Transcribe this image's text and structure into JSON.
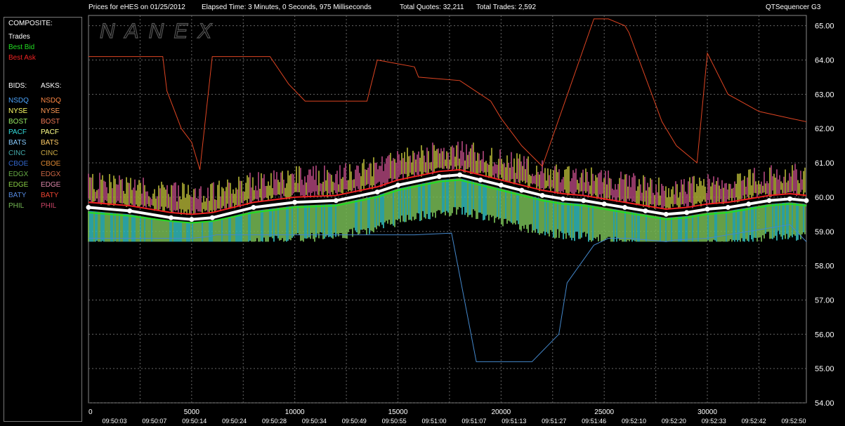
{
  "header": {
    "prices_label": "Prices for  eHES  on  01/25/2012",
    "elapsed": "Elapsed Time: 3 Minutes, 0 Seconds, 975 Milliseconds",
    "quotes": "Total Quotes: 32,211",
    "trades": "Total Trades: 2,592",
    "app": "QTSequencer G3"
  },
  "watermark": "NANEX",
  "legend": {
    "composite_title": "COMPOSITE:",
    "composite_items": [
      {
        "label": "Trades",
        "color": "#ffffff"
      },
      {
        "label": "Best Bid",
        "color": "#22dd22"
      },
      {
        "label": "Best Ask",
        "color": "#ee2222"
      }
    ],
    "bids_title": "BIDS:",
    "asks_title": "ASKS:",
    "exchanges": [
      {
        "bid": "NSDQ",
        "ask": "NSDQ",
        "bid_color": "#4da6ff",
        "ask_color": "#ff8844"
      },
      {
        "bid": "NYSE",
        "ask": "NYSE",
        "bid_color": "#ffff66",
        "ask_color": "#ff9955"
      },
      {
        "bid": "BOST",
        "ask": "BOST",
        "bid_color": "#99ee66",
        "ask_color": "#ee7755"
      },
      {
        "bid": "PACF",
        "ask": "PACF",
        "bid_color": "#33dddd",
        "ask_color": "#ffff88"
      },
      {
        "bid": "BATS",
        "ask": "BATS",
        "bid_color": "#88ccff",
        "ask_color": "#ffcc66"
      },
      {
        "bid": "CINC",
        "ask": "CINC",
        "bid_color": "#44aaaa",
        "ask_color": "#ccaa44"
      },
      {
        "bid": "CBOE",
        "ask": "CBOE",
        "bid_color": "#3366cc",
        "ask_color": "#dd8833"
      },
      {
        "bid": "EDGX",
        "ask": "EDGX",
        "bid_color": "#66aa44",
        "ask_color": "#cc6644"
      },
      {
        "bid": "EDGE",
        "ask": "EDGE",
        "bid_color": "#88cc44",
        "ask_color": "#dd88aa"
      },
      {
        "bid": "BATY",
        "ask": "BATY",
        "bid_color": "#5588dd",
        "ask_color": "#ee4433"
      },
      {
        "bid": "PHIL",
        "ask": "PHIL",
        "bid_color": "#77bb55",
        "ask_color": "#cc4466"
      }
    ]
  },
  "chart_data": {
    "type": "line",
    "title": "Prices for  eHES  on  01/25/2012",
    "ylim": [
      54.0,
      65.3
    ],
    "y_ticks": [
      "54.00",
      "55.00",
      "56.00",
      "57.00",
      "58.00",
      "59.00",
      "60.00",
      "61.00",
      "62.00",
      "63.00",
      "64.00",
      "65.00"
    ],
    "xlim": [
      0,
      34800
    ],
    "x_ticks": [
      "0",
      "5000",
      "10000",
      "15000",
      "20000",
      "25000",
      "30000"
    ],
    "time_labels": [
      "09:50:03",
      "09:50:07",
      "09:50:14",
      "09:50:24",
      "09:50:28",
      "09:50:34",
      "09:50:49",
      "09:50:55",
      "09:51:00",
      "09:51:07",
      "09:51:13",
      "09:51:27",
      "09:51:46",
      "09:52:10",
      "09:52:20",
      "09:52:33",
      "09:52:42",
      "09:52:50"
    ],
    "grid": true,
    "colors": {
      "trades": "#ffffff",
      "best_bid": "#22dd22",
      "best_ask": "#ee2222",
      "ask_line": "#dd4422",
      "bid_line": "#4488cc",
      "band_top": "#aa4477",
      "band_mid": "#aaaa33",
      "band_bid": "#77bb55"
    },
    "series": [
      {
        "name": "Trades",
        "x": [
          0,
          2000,
          4000,
          5000,
          6000,
          8000,
          10000,
          12000,
          14000,
          15000,
          17000,
          18000,
          19000,
          20000,
          21000,
          22000,
          23000,
          24000,
          25000,
          26000,
          27000,
          28000,
          29000,
          30000,
          31000,
          32000,
          33000,
          34000,
          34800
        ],
        "y": [
          59.7,
          59.6,
          59.4,
          59.35,
          59.4,
          59.7,
          59.85,
          59.9,
          60.15,
          60.35,
          60.6,
          60.65,
          60.5,
          60.35,
          60.2,
          60.05,
          59.95,
          59.9,
          59.8,
          59.7,
          59.6,
          59.5,
          59.55,
          59.65,
          59.7,
          59.8,
          59.9,
          59.95,
          59.9
        ]
      },
      {
        "name": "Best Bid",
        "x": [
          0,
          2000,
          4000,
          5000,
          6000,
          8000,
          10000,
          12000,
          14000,
          15000,
          17000,
          18000,
          19000,
          20000,
          21000,
          22000,
          23000,
          24000,
          25000,
          26000,
          27000,
          28000,
          29000,
          30000,
          31000,
          32000,
          33000,
          34000,
          34800
        ],
        "y": [
          59.55,
          59.45,
          59.3,
          59.25,
          59.3,
          59.55,
          59.7,
          59.75,
          60.0,
          60.2,
          60.45,
          60.5,
          60.35,
          60.2,
          60.05,
          59.9,
          59.8,
          59.75,
          59.65,
          59.55,
          59.45,
          59.35,
          59.4,
          59.5,
          59.55,
          59.65,
          59.75,
          59.8,
          59.75
        ]
      },
      {
        "name": "Best Ask",
        "x": [
          0,
          2000,
          4000,
          5000,
          6000,
          8000,
          10000,
          12000,
          14000,
          15000,
          17000,
          18000,
          19000,
          20000,
          21000,
          22000,
          23000,
          24000,
          25000,
          26000,
          27000,
          28000,
          29000,
          30000,
          31000,
          32000,
          33000,
          34000,
          34800
        ],
        "y": [
          59.85,
          59.75,
          59.55,
          59.5,
          59.55,
          59.85,
          60.0,
          60.05,
          60.3,
          60.5,
          60.75,
          60.8,
          60.65,
          60.5,
          60.35,
          60.2,
          60.1,
          60.05,
          59.95,
          59.85,
          59.75,
          59.65,
          59.7,
          59.8,
          59.85,
          59.95,
          60.05,
          60.1,
          60.05
        ]
      },
      {
        "name": "Ask Quote",
        "x": [
          0,
          2200,
          2200,
          3600,
          3800,
          4500,
          5000,
          5400,
          6000,
          7500,
          8000,
          8800,
          9700,
          10500,
          11000,
          12000,
          13500,
          14000,
          15800,
          16000,
          18000,
          18500,
          19500,
          20000,
          21000,
          22000,
          24500,
          25200,
          26000,
          26200,
          27000,
          27800,
          28500,
          29500,
          30000,
          31000,
          32500,
          34000,
          34800
        ],
        "y": [
          64.1,
          64.1,
          64.1,
          64.1,
          63.1,
          62.0,
          61.6,
          60.8,
          64.1,
          64.1,
          64.1,
          64.1,
          63.3,
          62.8,
          62.8,
          62.8,
          62.8,
          64.0,
          63.8,
          63.5,
          63.4,
          63.2,
          62.8,
          62.3,
          61.5,
          60.9,
          65.2,
          65.2,
          65.0,
          64.8,
          63.5,
          62.2,
          61.5,
          61.0,
          64.2,
          63.0,
          62.5,
          62.3,
          62.2
        ]
      },
      {
        "name": "Bid Quote",
        "x": [
          0,
          1400,
          1400,
          2400,
          2400,
          4000,
          5000,
          5800,
          6200,
          10000,
          10300,
          12000,
          14000,
          15800,
          17600,
          18800,
          19200,
          19700,
          20000,
          21400,
          21500,
          22800,
          23200,
          24500,
          25200,
          26200,
          28000,
          28400,
          30000,
          32000,
          34000,
          34800
        ],
        "y": [
          58.8,
          58.8,
          58.8,
          58.8,
          58.8,
          58.8,
          58.8,
          58.85,
          58.9,
          58.9,
          58.9,
          58.9,
          58.9,
          58.9,
          58.95,
          55.2,
          55.2,
          55.2,
          55.2,
          55.2,
          55.2,
          56.0,
          57.5,
          58.6,
          58.8,
          58.8,
          58.7,
          58.75,
          58.8,
          59.0,
          59.2,
          58.7
        ]
      }
    ]
  }
}
